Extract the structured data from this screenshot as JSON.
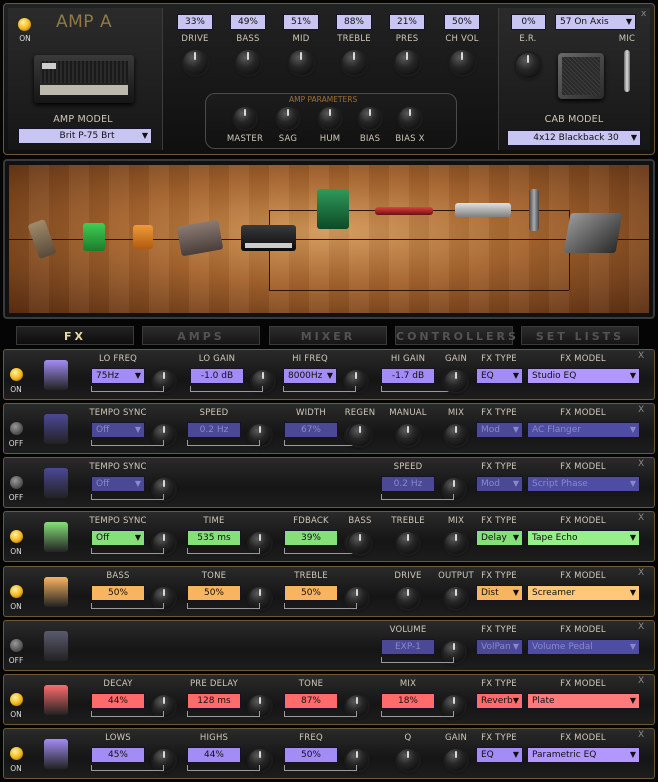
{
  "amp": {
    "power": "ON",
    "title": "AMP A",
    "close": "x",
    "model_label": "AMP MODEL",
    "model": "Brit P-75 Brt",
    "cab_label": "CAB MODEL",
    "cab": "4x12 Blackback 30",
    "mic_label": "MIC",
    "er_label": "E.R.",
    "er_value": "0%",
    "mic_pos": "57 On Axis",
    "params_title": "AMP PARAMETERS",
    "knobs": [
      {
        "label": "DRIVE",
        "value": "33%"
      },
      {
        "label": "BASS",
        "value": "49%"
      },
      {
        "label": "MID",
        "value": "51%"
      },
      {
        "label": "TREBLE",
        "value": "88%"
      },
      {
        "label": "PRES",
        "value": "21%"
      },
      {
        "label": "CH VOL",
        "value": "50%"
      }
    ],
    "params": [
      "MASTER",
      "SAG",
      "HUM",
      "BIAS",
      "BIAS X"
    ]
  },
  "tabs": [
    "FX",
    "AMPS",
    "MIXER",
    "CONTROLLERS",
    "SET LISTS"
  ],
  "fx": [
    {
      "power": "ON",
      "on": true,
      "close": "X",
      "type": "EQ",
      "model": "Studio EQ",
      "c1": "#a38cf5",
      "c2": "#b297ff",
      "ctrl": [
        {
          "l": "LO FREQ",
          "v": "75Hz",
          "sel": true
        },
        {
          "l": "LO GAIN",
          "v": "-1.0 dB"
        },
        {
          "l": "HI FREQ",
          "v": "8000Hz",
          "sel": true
        },
        {
          "l": "HI GAIN",
          "v": "-1.7 dB"
        },
        {
          "l": "GAIN"
        }
      ]
    },
    {
      "power": "OFF",
      "on": false,
      "close": "X",
      "type": "Mod",
      "model": "AC Flanger",
      "c1": "#4b4896",
      "c2": "#4f4ca4",
      "ctrl": [
        {
          "l": "TEMPO SYNC",
          "v": "Off",
          "sel": true
        },
        {
          "l": "SPEED",
          "v": "0.2 Hz"
        },
        {
          "l": "WIDTH",
          "v": "67%"
        },
        {
          "l": "REGEN"
        },
        {
          "l": "MANUAL"
        },
        {
          "l": "MIX"
        }
      ]
    },
    {
      "power": "OFF",
      "on": false,
      "close": "X",
      "type": "Mod",
      "model": "Script Phase",
      "c1": "#4b4896",
      "c2": "#4f4ca4",
      "ctrl": [
        {
          "l": "TEMPO SYNC",
          "v": "Off",
          "sel": true
        },
        {
          "l": "SPEED",
          "v": "0.2 Hz"
        }
      ]
    },
    {
      "power": "ON",
      "on": true,
      "close": "X",
      "type": "Delay",
      "model": "Tape Echo",
      "c1": "#86e07a",
      "c2": "#97ef8b",
      "ctrl": [
        {
          "l": "TEMPO SYNC",
          "v": "Off",
          "sel": true
        },
        {
          "l": "TIME",
          "v": "535 ms"
        },
        {
          "l": "FDBACK",
          "v": "39%"
        },
        {
          "l": "BASS"
        },
        {
          "l": "TREBLE"
        },
        {
          "l": "MIX"
        }
      ]
    },
    {
      "power": "ON",
      "on": true,
      "close": "X",
      "type": "Dist",
      "model": "Screamer",
      "c1": "#f7b560",
      "c2": "#ffc878",
      "ctrl": [
        {
          "l": "BASS",
          "v": "50%"
        },
        {
          "l": "TONE",
          "v": "50%"
        },
        {
          "l": "TREBLE",
          "v": "50%"
        },
        {
          "l": "DRIVE"
        },
        {
          "l": "OUTPUT"
        }
      ]
    },
    {
      "power": "OFF",
      "on": false,
      "close": "X",
      "type": "VolPan",
      "model": "Volume Pedal",
      "c1": "#5a5a6e",
      "c2": "#6a6a7e",
      "ctrl": [
        {
          "l": "VOLUME",
          "v": "EXP-1"
        }
      ]
    },
    {
      "power": "ON",
      "on": true,
      "close": "X",
      "type": "Reverb",
      "model": "Plate",
      "c1": "#ff6b6b",
      "c2": "#ff7b7b",
      "ctrl": [
        {
          "l": "DECAY",
          "v": "44%"
        },
        {
          "l": "PRE DELAY",
          "v": "128 ms"
        },
        {
          "l": "TONE",
          "v": "87%"
        },
        {
          "l": "MIX",
          "v": "18%"
        }
      ]
    },
    {
      "power": "ON",
      "on": true,
      "close": "X",
      "type": "EQ",
      "model": "Parametric EQ",
      "c1": "#a38cf5",
      "c2": "#b297ff",
      "ctrl": [
        {
          "l": "LOWS",
          "v": "45%"
        },
        {
          "l": "HIGHS",
          "v": "44%"
        },
        {
          "l": "FREQ",
          "v": "50%"
        },
        {
          "l": "Q"
        },
        {
          "l": "GAIN"
        }
      ]
    }
  ]
}
